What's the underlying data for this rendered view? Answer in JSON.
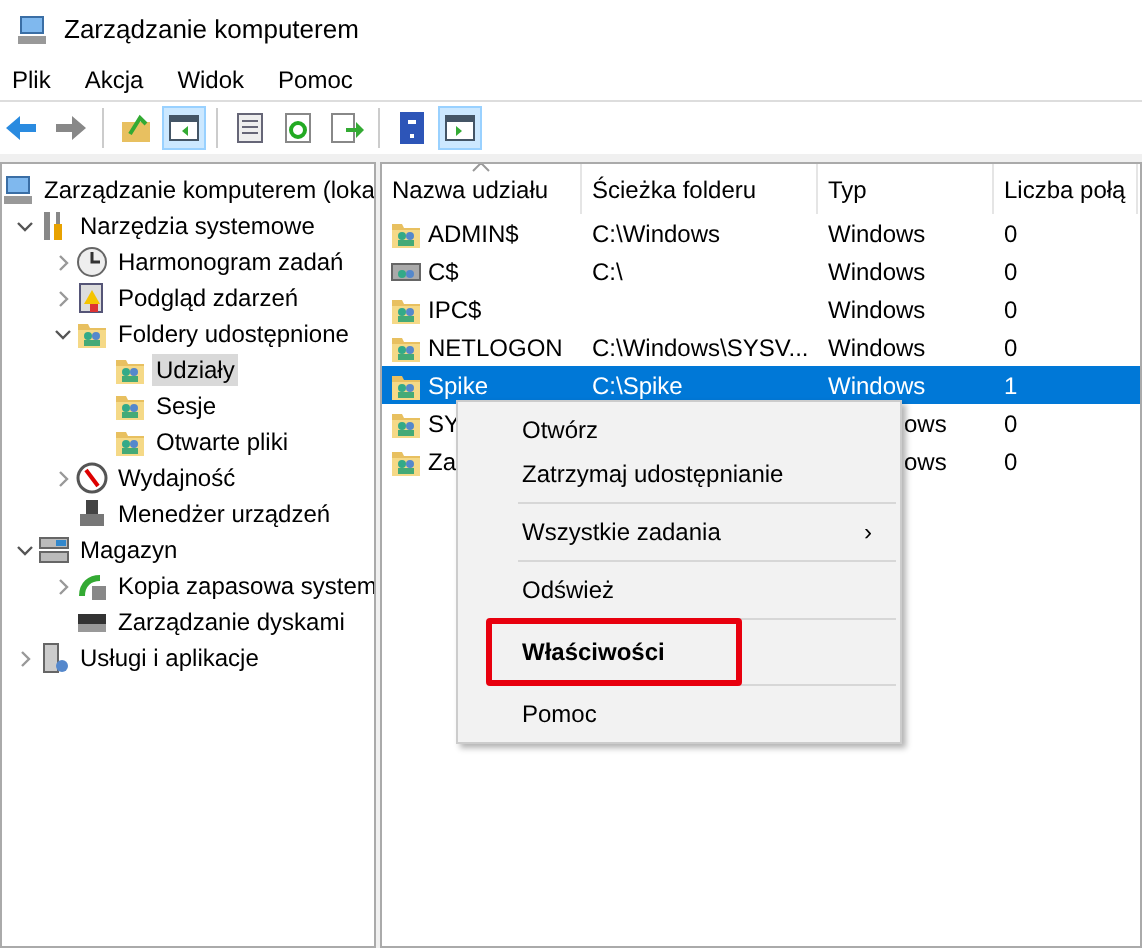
{
  "window": {
    "title": "Zarządzanie komputerem"
  },
  "menu_bar": [
    "Plik",
    "Akcja",
    "Widok",
    "Pomoc"
  ],
  "toolbar": [
    {
      "kind": "back",
      "pressed": false
    },
    {
      "kind": "forward",
      "pressed": false
    },
    {
      "kind": "sep"
    },
    {
      "kind": "up",
      "pressed": false
    },
    {
      "kind": "tree",
      "pressed": true
    },
    {
      "kind": "sep"
    },
    {
      "kind": "props",
      "pressed": false
    },
    {
      "kind": "refresh",
      "pressed": false
    },
    {
      "kind": "export",
      "pressed": false
    },
    {
      "kind": "sep"
    },
    {
      "kind": "help",
      "pressed": false
    },
    {
      "kind": "pane",
      "pressed": true
    }
  ],
  "tree": [
    {
      "label": "Zarządzanie komputerem (loka",
      "kind": "computer",
      "selected": false,
      "children": [
        {
          "label": "Narzędzia systemowe",
          "kind": "tools",
          "expanded": true,
          "selected": false,
          "children": [
            {
              "label": "Harmonogram zadań",
              "kind": "clock",
              "expanded": false,
              "selected": false
            },
            {
              "label": "Podgląd zdarzeń",
              "kind": "log",
              "expanded": false,
              "selected": false
            },
            {
              "label": "Foldery udostępnione",
              "kind": "share",
              "expanded": true,
              "selected": false,
              "children": [
                {
                  "label": "Udziały",
                  "kind": "share",
                  "selected": true
                },
                {
                  "label": "Sesje",
                  "kind": "share",
                  "selected": false
                },
                {
                  "label": "Otwarte pliki",
                  "kind": "share",
                  "selected": false
                }
              ]
            },
            {
              "label": "Wydajność",
              "kind": "gauge",
              "expanded": false,
              "selected": false
            },
            {
              "label": "Menedżer urządzeń",
              "kind": "device",
              "selected": false
            }
          ]
        },
        {
          "label": "Magazyn",
          "kind": "storage",
          "expanded": true,
          "selected": false,
          "children": [
            {
              "label": "Kopia zapasowa system",
              "kind": "backup",
              "expanded": false,
              "selected": false
            },
            {
              "label": "Zarządzanie dyskami",
              "kind": "disk",
              "selected": false
            }
          ]
        },
        {
          "label": "Usługi i aplikacje",
          "kind": "services",
          "expanded": false,
          "selected": false
        }
      ]
    }
  ],
  "table": {
    "columns": [
      "Nazwa udziału",
      "Ścieżka folderu",
      "Typ",
      "Liczba połą"
    ],
    "rows": [
      {
        "cells": [
          "ADMIN$",
          "C:\\Windows",
          "Windows",
          "0"
        ],
        "kind": "share",
        "selected": false
      },
      {
        "cells": [
          "C$",
          "C:\\",
          "Windows",
          "0"
        ],
        "kind": "drive",
        "selected": false
      },
      {
        "cells": [
          "IPC$",
          "",
          "Windows",
          "0"
        ],
        "kind": "share",
        "selected": false
      },
      {
        "cells": [
          "NETLOGON",
          "C:\\Windows\\SYSV...",
          "Windows",
          "0"
        ],
        "kind": "share",
        "selected": false
      },
      {
        "cells": [
          "Spike",
          "C:\\Spike",
          "Windows",
          "1"
        ],
        "kind": "share",
        "selected": true
      },
      {
        "cells": [
          "SY",
          "",
          "ows",
          "0"
        ],
        "kind": "share",
        "selected": false
      },
      {
        "cells": [
          "Za",
          "",
          "ows",
          "0"
        ],
        "kind": "share",
        "selected": false
      }
    ]
  },
  "context_menu": [
    {
      "kind": "item",
      "label": "Otwórz",
      "bold": false,
      "highlighted": false
    },
    {
      "kind": "item",
      "label": "Zatrzymaj udostępnianie",
      "bold": false,
      "highlighted": false
    },
    {
      "kind": "separator"
    },
    {
      "kind": "submenu",
      "label": "Wszystkie zadania",
      "arrow": "›",
      "bold": false,
      "highlighted": false
    },
    {
      "kind": "separator"
    },
    {
      "kind": "item",
      "label": "Odśwież",
      "bold": false,
      "highlighted": false
    },
    {
      "kind": "separator"
    },
    {
      "kind": "item",
      "label": "Właściwości",
      "bold": true,
      "highlighted": true
    },
    {
      "kind": "separator"
    },
    {
      "kind": "item",
      "label": "Pomoc",
      "bold": false,
      "highlighted": false
    }
  ]
}
